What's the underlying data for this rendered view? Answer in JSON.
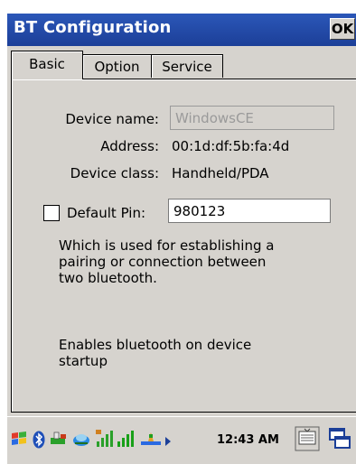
{
  "window": {
    "title": "BT Configuration",
    "ok_label": "OK"
  },
  "tabs": [
    {
      "label": "Basic",
      "active": true
    },
    {
      "label": "Option",
      "active": false
    },
    {
      "label": "Service",
      "active": false
    }
  ],
  "form": {
    "device_name_label": "Device name:",
    "device_name_value": "WindowsCE",
    "address_label": "Address:",
    "address_value": "00:1d:df:5b:fa:4d",
    "device_class_label": "Device class:",
    "device_class_value": "Handheld/PDA",
    "default_pin_label": "Default Pin:",
    "default_pin_checked": false,
    "default_pin_value": "980123"
  },
  "descriptions": {
    "pin_help": "Which is used for establishing a\npairing or connection between\ntwo bluetooth.",
    "startup_help": "Enables bluetooth on device\nstartup"
  },
  "taskbar": {
    "icons": [
      "start-flag-icon",
      "bluetooth-icon",
      "usb-sync-icon",
      "network-icon",
      "signal-strength-icon",
      "signal-bars-icon",
      "connection-icon",
      "volume-arrow-icon",
      "keyboard-icon",
      "switch-window-icon"
    ],
    "time": "12:43 AM"
  },
  "colors": {
    "title_bar": "#1f44a0",
    "background": "#d6d3ce"
  }
}
